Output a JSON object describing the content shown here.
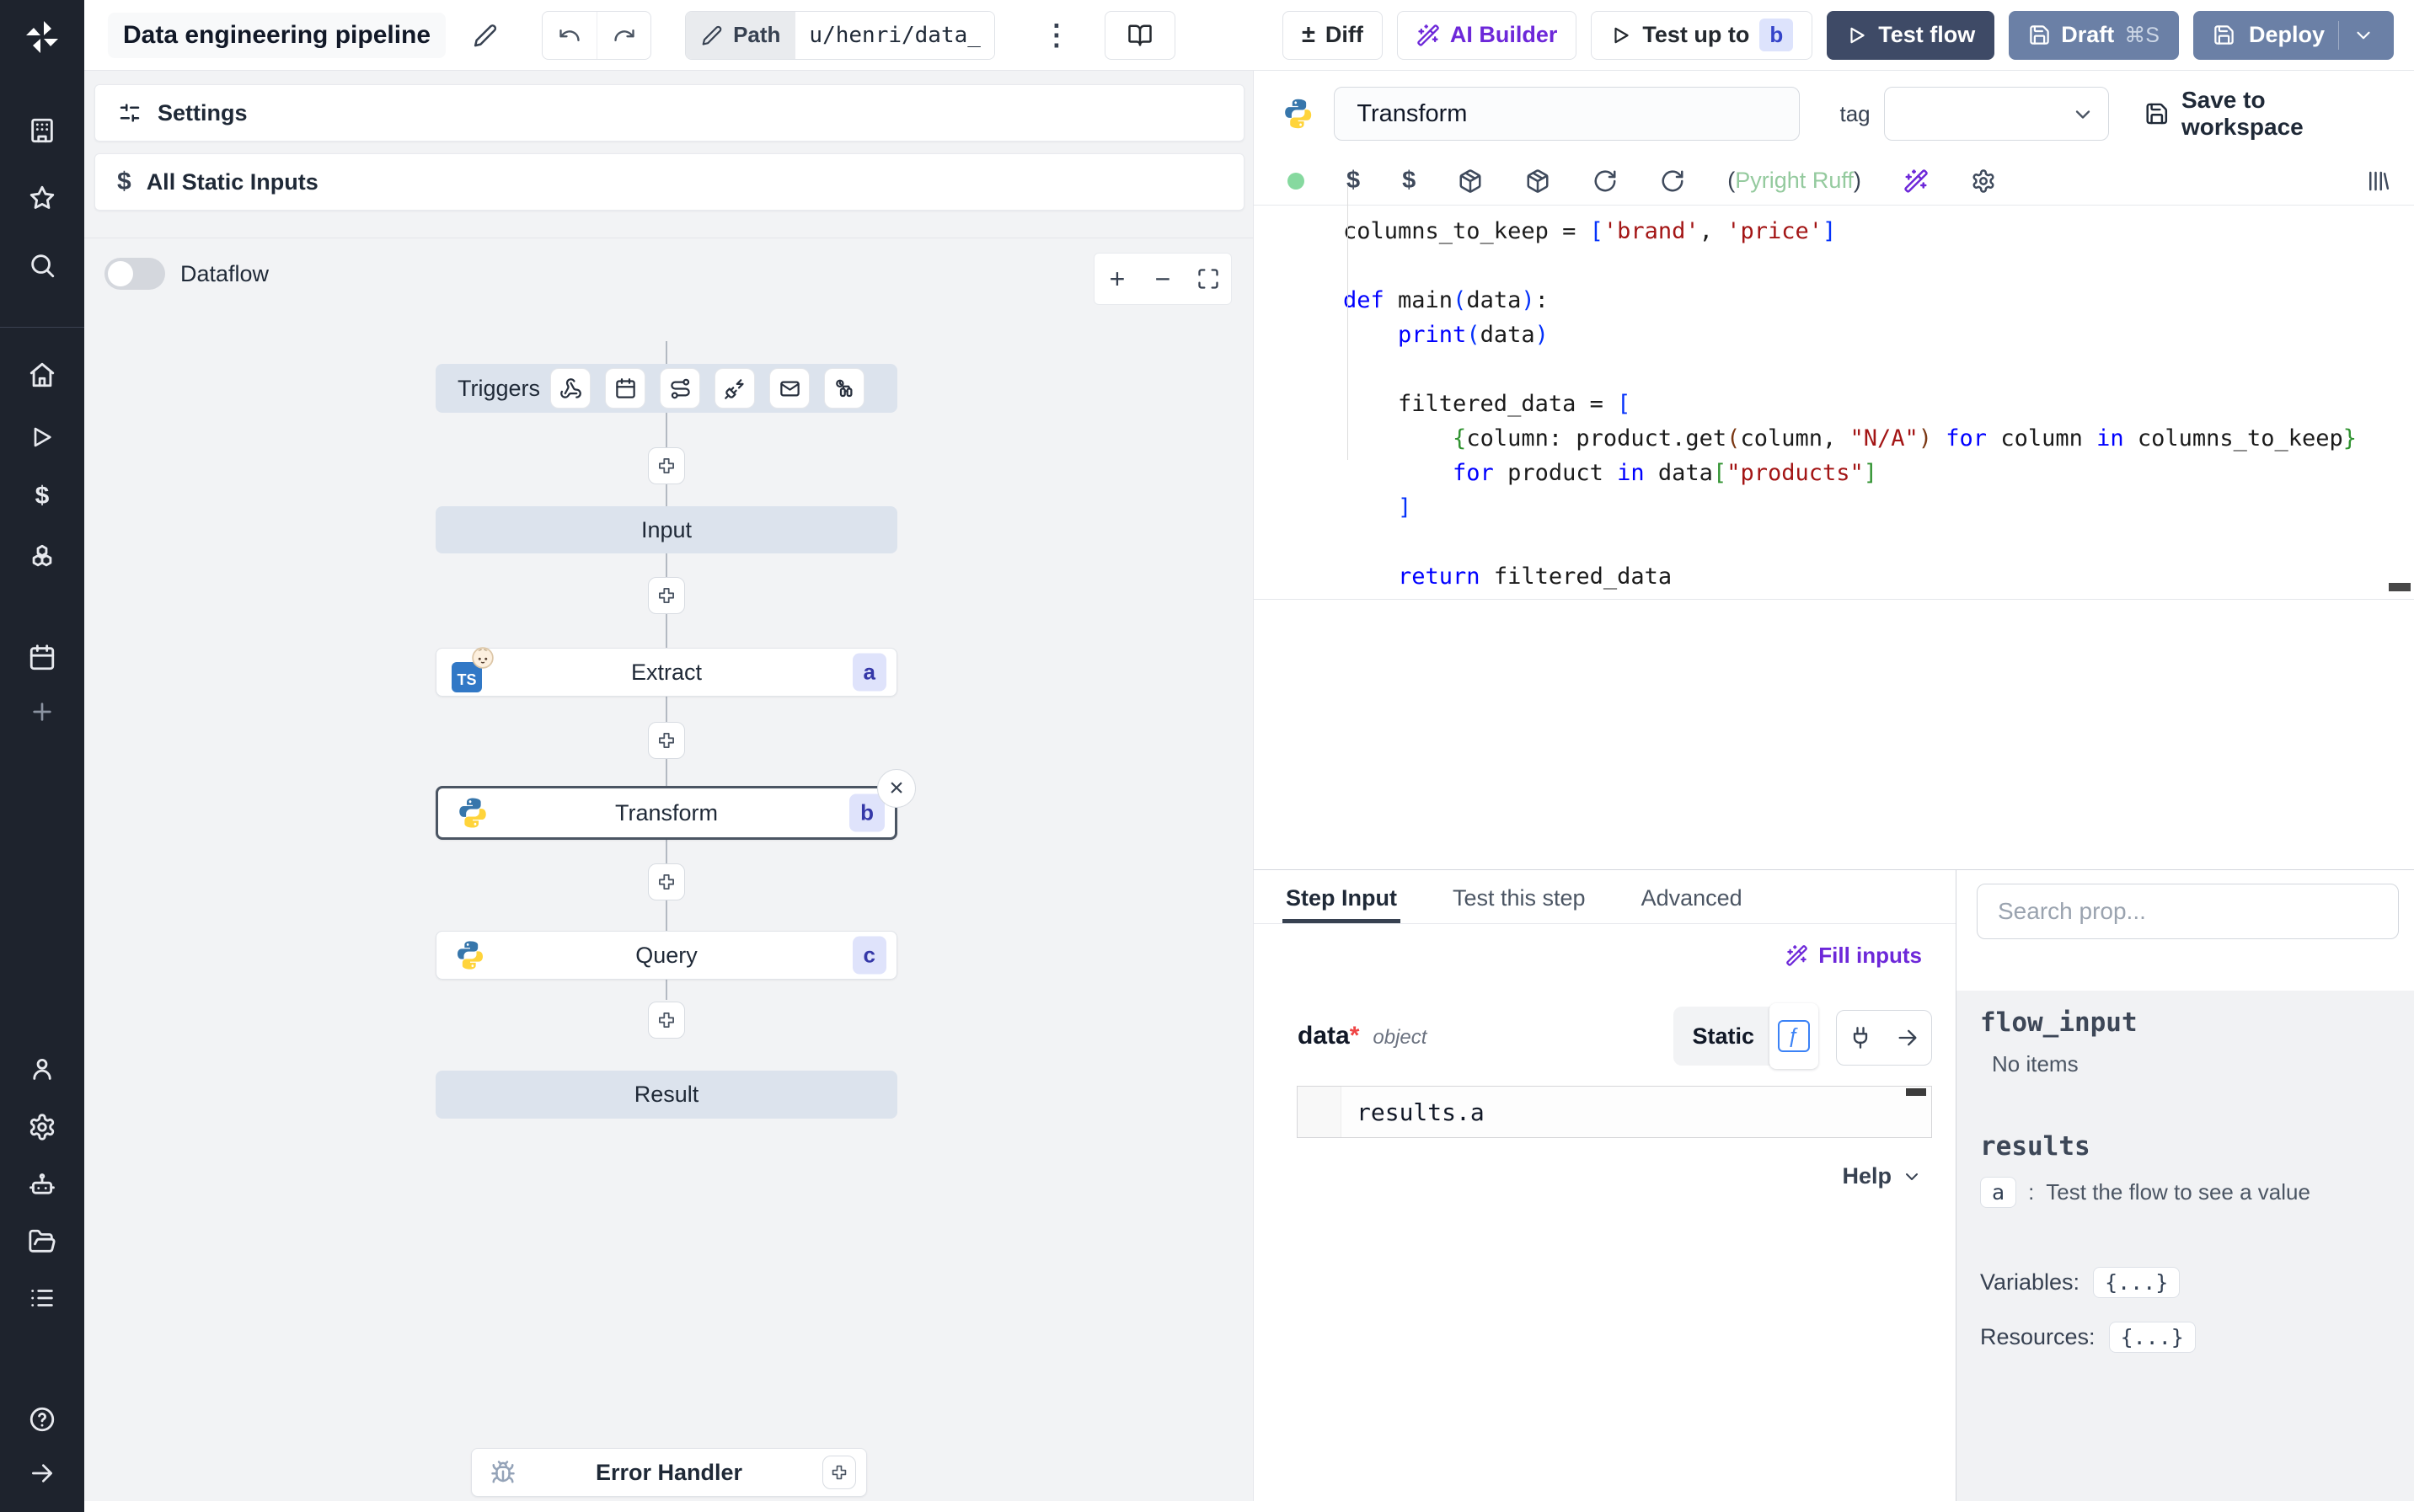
{
  "topbar": {
    "title": "Data engineering pipeline",
    "path_label": "Path",
    "path_value": "u/henri/data_",
    "diff_label": "Diff",
    "ai_builder_label": "AI Builder",
    "test_up_to_label": "Test up to",
    "test_up_to_badge": "b",
    "test_flow_label": "Test flow",
    "draft_label": "Draft",
    "draft_shortcut": "⌘S",
    "deploy_label": "Deploy"
  },
  "flow": {
    "settings_label": "Settings",
    "all_static_inputs_label": "All Static Inputs",
    "dataflow_label": "Dataflow",
    "triggers_label": "Triggers",
    "input_label": "Input",
    "extract": {
      "label": "Extract",
      "badge": "a"
    },
    "transform": {
      "label": "Transform",
      "badge": "b"
    },
    "query": {
      "label": "Query",
      "badge": "c"
    },
    "result_label": "Result",
    "error_handler_label": "Error Handler"
  },
  "editor": {
    "step_name": "Transform",
    "tag_label": "tag",
    "save_label": "Save to workspace",
    "lint_open": "(",
    "lint_name": "Pyright Ruff",
    "lint_close": ")",
    "code": [
      [
        [
          "p",
          "columns_to_keep = "
        ],
        [
          "b1",
          "["
        ],
        [
          "s",
          "'brand'"
        ],
        [
          "p",
          ", "
        ],
        [
          "s",
          "'price'"
        ],
        [
          "b1",
          "]"
        ]
      ],
      [],
      [
        [
          "k",
          "def "
        ],
        [
          "p",
          "main"
        ],
        [
          "b1",
          "("
        ],
        [
          "p",
          "data"
        ],
        [
          "b1",
          ")"
        ],
        [
          "p",
          ":"
        ]
      ],
      [
        [
          "p",
          "    "
        ],
        [
          "k",
          "print"
        ],
        [
          "b1",
          "("
        ],
        [
          "p",
          "data"
        ],
        [
          "b1",
          ")"
        ]
      ],
      [],
      [
        [
          "p",
          "    filtered_data = "
        ],
        [
          "b1",
          "["
        ]
      ],
      [
        [
          "p",
          "        "
        ],
        [
          "b2",
          "{"
        ],
        [
          "p",
          "column: product.get"
        ],
        [
          "b3",
          "("
        ],
        [
          "p",
          "column, "
        ],
        [
          "s",
          "\"N/A\""
        ],
        [
          "b3",
          ")"
        ],
        [
          "p",
          " "
        ],
        [
          "k",
          "for"
        ],
        [
          "p",
          " column "
        ],
        [
          "k",
          "in"
        ],
        [
          "p",
          " columns_to_keep"
        ],
        [
          "b2",
          "}"
        ]
      ],
      [
        [
          "p",
          "        "
        ],
        [
          "k",
          "for"
        ],
        [
          "p",
          " product "
        ],
        [
          "k",
          "in"
        ],
        [
          "p",
          " data"
        ],
        [
          "b2",
          "["
        ],
        [
          "s",
          "\"products\""
        ],
        [
          "b2",
          "]"
        ]
      ],
      [
        [
          "p",
          "    "
        ],
        [
          "b1",
          "]"
        ]
      ],
      [],
      [
        [
          "p",
          "    "
        ],
        [
          "k",
          "return"
        ],
        [
          "p",
          " filtered_data"
        ]
      ]
    ]
  },
  "tabs": {
    "step_input": "Step Input",
    "test_this_step": "Test this step",
    "advanced": "Advanced"
  },
  "step_input": {
    "fill_inputs_label": "Fill inputs",
    "arg_name": "data",
    "required_mark": "*",
    "arg_type": "object",
    "static_label": "Static",
    "expression": "results.a",
    "help_label": "Help"
  },
  "props": {
    "search_placeholder": "Search prop...",
    "flow_input_label": "flow_input",
    "no_items": "No items",
    "results_label": "results",
    "result_key": "a",
    "colon": ":",
    "result_hint": "Test the flow to see a value",
    "variables_label": "Variables:",
    "resources_label": "Resources:",
    "braces_value": "{...}"
  },
  "icons": {
    "dollar": "$",
    "plus": "+",
    "minus": "−",
    "kebab": "⋮",
    "close": "×",
    "plusminus": "±",
    "fx": "ƒ",
    "arrow_right": "→",
    "ts": "TS",
    "question": "?"
  },
  "colors": {
    "accent_violet": "#6d28d9",
    "badge_bg": "#dfe3fb",
    "badge_text": "#3538a8",
    "dark_button": "#3e4a66",
    "slate_button": "#6b80a6",
    "lint_green": "#94ca9e",
    "status_green": "#86d99f",
    "node_slate": "#dce3ed",
    "sidebar_bg": "#1e232d"
  }
}
